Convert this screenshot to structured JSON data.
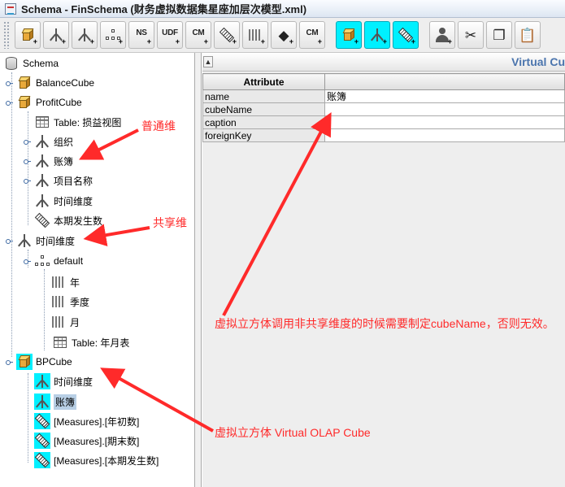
{
  "window": {
    "title": "Schema - FinSchema (财务虚拟数据集星座加层次模型.xml)"
  },
  "toolbar": {
    "buttons": [
      {
        "name": "add-cube",
        "icon": "cube-plus-icon"
      },
      {
        "name": "add-dimension",
        "icon": "dimension-plus-icon"
      },
      {
        "name": "add-dimension-usage",
        "icon": "dimension-usage-plus-icon"
      },
      {
        "name": "add-hierarchy",
        "icon": "hierarchy-plus-icon"
      },
      {
        "name": "add-named-set",
        "icon": "named-set-icon",
        "label": "NS"
      },
      {
        "name": "add-udf",
        "icon": "udf-icon",
        "label": "UDF"
      },
      {
        "name": "add-calculated-member",
        "icon": "calculated-member-icon",
        "label": "CM"
      },
      {
        "name": "add-measure",
        "icon": "measure-plus-icon"
      },
      {
        "name": "add-level",
        "icon": "level-plus-icon"
      },
      {
        "name": "add-property",
        "icon": "property-plus-icon"
      },
      {
        "name": "add-calculated-member-2",
        "icon": "calculated-member-2-icon",
        "label": "CM"
      },
      {
        "name": "add-virtual-cube",
        "icon": "virtual-cube-icon",
        "active": true
      },
      {
        "name": "add-virtual-dimension",
        "icon": "virtual-dimension-icon",
        "active": true
      },
      {
        "name": "add-virtual-measure",
        "icon": "virtual-measure-icon",
        "active": true
      },
      {
        "name": "add-role",
        "icon": "role-person-icon"
      },
      {
        "name": "cut",
        "icon": "scissors-icon"
      },
      {
        "name": "copy",
        "icon": "copy-icon"
      },
      {
        "name": "paste",
        "icon": "clipboard-icon"
      }
    ]
  },
  "tree": {
    "schema": "Schema",
    "balance_cube": "BalanceCube",
    "profit_cube": "ProfitCube",
    "table_pl": "Table: 损益视图",
    "dim_org": "组织",
    "dim_ledger": "账簿",
    "dim_item": "项目名称",
    "dim_time_usage": "时间维度",
    "measure_current": "本期发生数",
    "shared_time_dim": "时间维度",
    "hier_default": "default",
    "level_year": "年",
    "level_quarter": "季度",
    "level_month": "月",
    "table_ym": "Table: 年月表",
    "bp_cube": "BPCube",
    "vdim_time": "时间维度",
    "vdim_ledger": "账簿",
    "vm_opening": "[Measures].[年初数]",
    "vm_closing": "[Measures].[期末数]",
    "vm_current": "[Measures].[本期发生数]"
  },
  "details": {
    "panel_title": "Virtual Cu",
    "column_header": "Attribute",
    "rows": [
      {
        "key": "name",
        "value": "账簿"
      },
      {
        "key": "cubeName",
        "value": ""
      },
      {
        "key": "caption",
        "value": ""
      },
      {
        "key": "foreignKey",
        "value": ""
      }
    ]
  },
  "annotations": {
    "normal_dim": "普通维",
    "shared_dim": "共享维",
    "cube_name_note": "虚拟立方体调用非共享维度的时候需要制定cubeName，否则无效。",
    "virtual_cube": "虚拟立方体 Virtual OLAP Cube",
    "color": "#ff2a2a"
  }
}
